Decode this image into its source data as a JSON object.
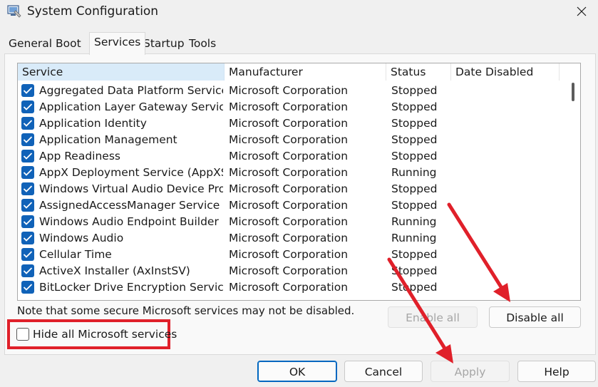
{
  "window": {
    "title": "System Configuration"
  },
  "tabs": [
    {
      "label": "General"
    },
    {
      "label": "Boot"
    },
    {
      "label": "Services"
    },
    {
      "label": "Startup"
    },
    {
      "label": "Tools"
    }
  ],
  "active_tab": "Services",
  "table": {
    "columns": [
      "Service",
      "Manufacturer",
      "Status",
      "Date Disabled"
    ],
    "rows": [
      {
        "name": "Aggregated Data Platform Service",
        "manufacturer": "Microsoft Corporation",
        "status": "Stopped",
        "checked": true
      },
      {
        "name": "Application Layer Gateway Service",
        "manufacturer": "Microsoft Corporation",
        "status": "Stopped",
        "checked": true
      },
      {
        "name": "Application Identity",
        "manufacturer": "Microsoft Corporation",
        "status": "Stopped",
        "checked": true
      },
      {
        "name": "Application Management",
        "manufacturer": "Microsoft Corporation",
        "status": "Stopped",
        "checked": true
      },
      {
        "name": "App Readiness",
        "manufacturer": "Microsoft Corporation",
        "status": "Stopped",
        "checked": true
      },
      {
        "name": "AppX Deployment Service (AppXS...",
        "manufacturer": "Microsoft Corporation",
        "status": "Running",
        "checked": true
      },
      {
        "name": "Windows Virtual Audio Device Pro...",
        "manufacturer": "Microsoft Corporation",
        "status": "Stopped",
        "checked": true
      },
      {
        "name": "AssignedAccessManager Service",
        "manufacturer": "Microsoft Corporation",
        "status": "Stopped",
        "checked": true
      },
      {
        "name": "Windows Audio Endpoint Builder",
        "manufacturer": "Microsoft Corporation",
        "status": "Running",
        "checked": true
      },
      {
        "name": "Windows Audio",
        "manufacturer": "Microsoft Corporation",
        "status": "Running",
        "checked": true
      },
      {
        "name": "Cellular Time",
        "manufacturer": "Microsoft Corporation",
        "status": "Stopped",
        "checked": true
      },
      {
        "name": "ActiveX Installer (AxInstSV)",
        "manufacturer": "Microsoft Corporation",
        "status": "Stopped",
        "checked": true
      },
      {
        "name": "BitLocker Drive Encryption Service",
        "manufacturer": "Microsoft Corporation",
        "status": "Stopped",
        "checked": true
      }
    ]
  },
  "note": "Note that some secure Microsoft services may not be disabled.",
  "buttons": {
    "enable_all": "Enable all",
    "disable_all": "Disable all",
    "ok": "OK",
    "cancel": "Cancel",
    "apply": "Apply",
    "help": "Help"
  },
  "hide_ms": {
    "label": "Hide all Microsoft services",
    "checked": false
  },
  "colors": {
    "accent": "#1062b8",
    "annotation": "#e0202a",
    "header_selected": "#d9ebf9"
  },
  "icons": {
    "app": "system-config-icon",
    "close": "close-icon",
    "check": "checkmark-icon"
  }
}
